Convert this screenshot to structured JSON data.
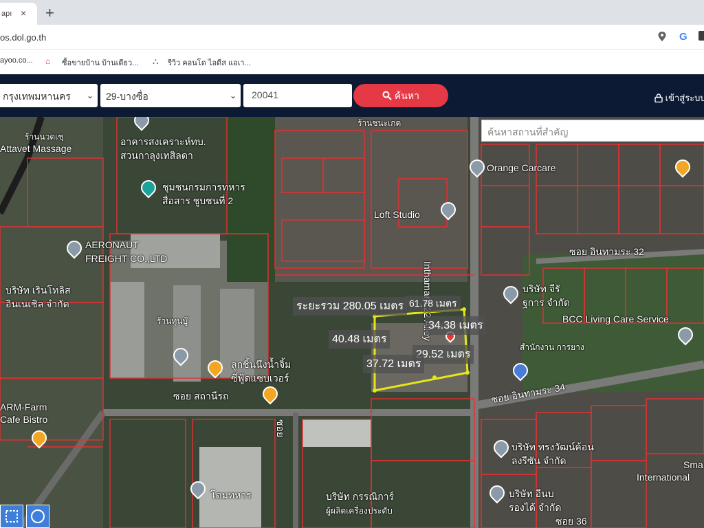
{
  "browser": {
    "tab_title": "apı",
    "tab_close": "×",
    "new_tab": "+",
    "url": "os.dol.go.th",
    "google_icon": "G",
    "bookmarks": [
      "ayoo.co...",
      "ซื้อขายบ้าน บ้านเดียว...",
      "รีวิว คอนโด ไอดีส แอเา..."
    ]
  },
  "header": {
    "province": "กรุงเทพมหานคร",
    "amphur": "29-บางซื่อ",
    "parcel_no": "20041",
    "search_label": "ค้นหา",
    "login_label": "เข้าสู่ระบบ"
  },
  "map": {
    "place_search_placeholder": "ค้นหาสถานที่สำคัญ",
    "labels": {
      "massage_th": "ร้านนวดเชฺ",
      "massage": "Attavet Massage",
      "housing1": "อาคารสงเคราะห์ทบ.",
      "housing2": "สวนกาลุงเทสิลดา",
      "orange_carcare": "Orange Carcare",
      "comm_center1": "ชุมชนกรมการทหาร",
      "comm_center2": "สื่อสาร ชูบชนที่ 2",
      "loft_studio": "Loft Studio",
      "inthamara_alley": "Inthamara 22 Alley",
      "aeronaut1": "AERONAUT",
      "aeronaut2": "FREIGHT CO.,LTD",
      "soi32": "ซอย อินทามระ 32",
      "company_left1": "บริษัท เรินโทลิส",
      "company_left2": "อินเนเชิล จำกัด",
      "bcc": "BCC Living Care Service",
      "company_right1": "บริษัท จีรั",
      "company_right2": "ฐการ จำกัด",
      "office_right": "สำนักงาน การยาง",
      "restaurant1": "ลูกชิ้นนึ่งน้ำจิ้ม",
      "restaurant2": "ซีฟู้ดแซบเวอร์",
      "shop_left": "ร้านทุนบู๊",
      "soi_station": "ซอย สถานีรถ",
      "farm_cafe1": "ARM-Farm",
      "farm_cafe2": "Cafe Bistro",
      "soi34": "ซอย อินทามระ 34",
      "soi_vertical": "ซอย",
      "dome": "โดมทหาร",
      "company_bottom1": "บริษัท ทรงวัฒน์ค้อน",
      "company_bottom2": "ลงรีซัน จำกัด",
      "international": "International",
      "sma": "Sma",
      "company_bottom_mid1": "บริษัท กรรณิการ์",
      "company_bottom_mid2": "ผู้ผลิตเครื่องประดับ",
      "company_bottom_right1": "บริษัท อีนบ",
      "company_bottom_right2": "รองได้ จำกัด",
      "soi36": "ซอย 36",
      "chanaket": "ร้านชนะเกด"
    },
    "measurements": {
      "area": "ระยะรวม 280.05 เมตร",
      "top": "61.78 เมตร",
      "right_top": "34.38 เมตร",
      "left": "40.48 เมตร",
      "middle": "29.52 เมตร",
      "bottom": "37.72 เมตร"
    }
  }
}
